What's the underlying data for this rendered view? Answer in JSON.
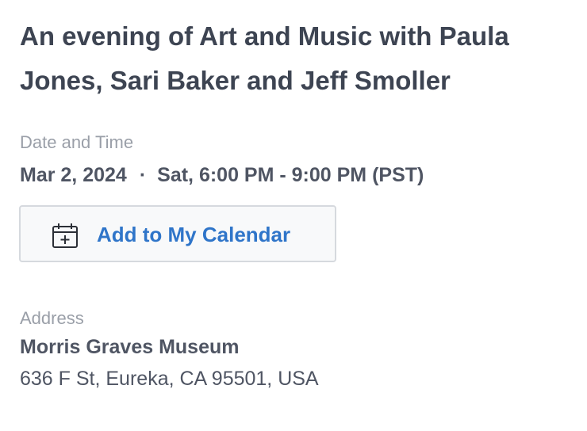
{
  "event": {
    "title": "An evening of Art and Music with Paula Jones, Sari Baker and Jeff Smoller"
  },
  "datetime": {
    "label": "Date and Time",
    "date": "Mar 2, 2024",
    "separator": "·",
    "time": "Sat, 6:00 PM - 9:00 PM (PST)"
  },
  "calendar_button": {
    "label": "Add to My Calendar",
    "icon": "calendar-add-icon",
    "text_color": "#2f75c9"
  },
  "address": {
    "label": "Address",
    "venue": "Morris Graves Museum",
    "street": "636 F St, Eureka, CA 95501, USA"
  }
}
